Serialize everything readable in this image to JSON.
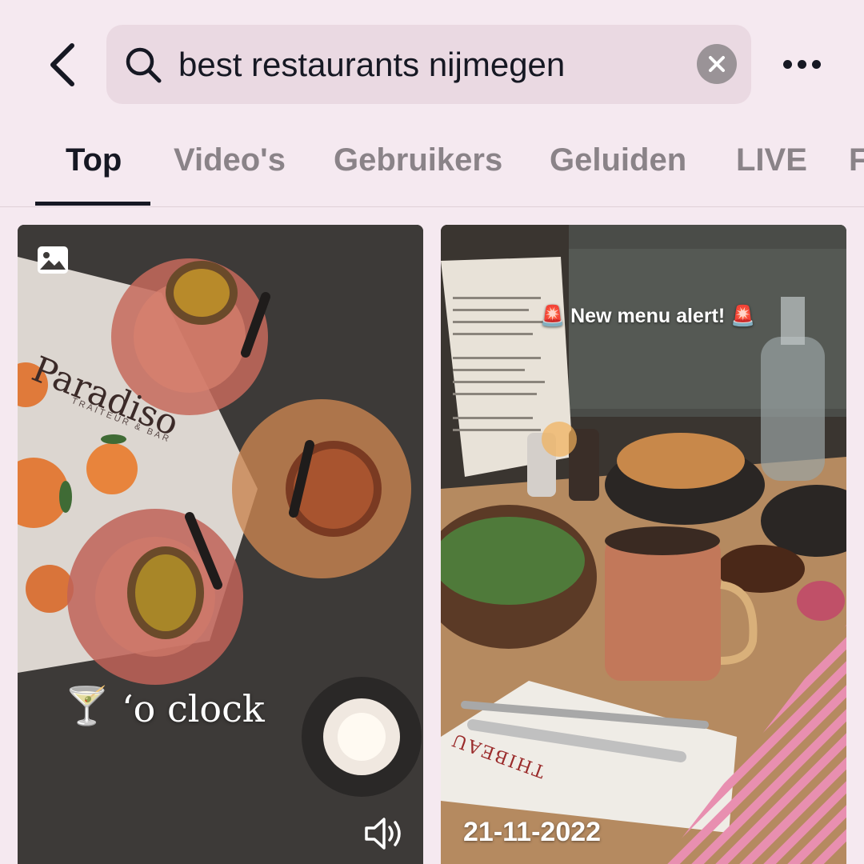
{
  "search": {
    "query": "best restaurants nijmegen"
  },
  "tabs": [
    {
      "label": "Top",
      "active": true
    },
    {
      "label": "Video's",
      "active": false
    },
    {
      "label": "Gebruikers",
      "active": false
    },
    {
      "label": "Geluiden",
      "active": false
    },
    {
      "label": "LIVE",
      "active": false
    },
    {
      "label": "F",
      "active": false
    }
  ],
  "results": [
    {
      "type": "photo",
      "menu_brand": "Paradiso",
      "menu_subtitle": "TRAITEUR & BAR",
      "caption_emoji": "🍸",
      "caption": "‘o clock",
      "icons": [
        "image-icon",
        "sound-icon"
      ]
    },
    {
      "type": "video",
      "overlay_text": "New menu alert!",
      "overlay_emoji": "🚨",
      "napkin_brand": "THIBEAU",
      "date": "21-11-2022"
    }
  ],
  "colors": {
    "background": "#f5e9f0",
    "search_bg": "#ead9e2",
    "active_tab": "#161823",
    "inactive_tab": "#8a8388",
    "accent_stripes": "#e88fb0"
  }
}
